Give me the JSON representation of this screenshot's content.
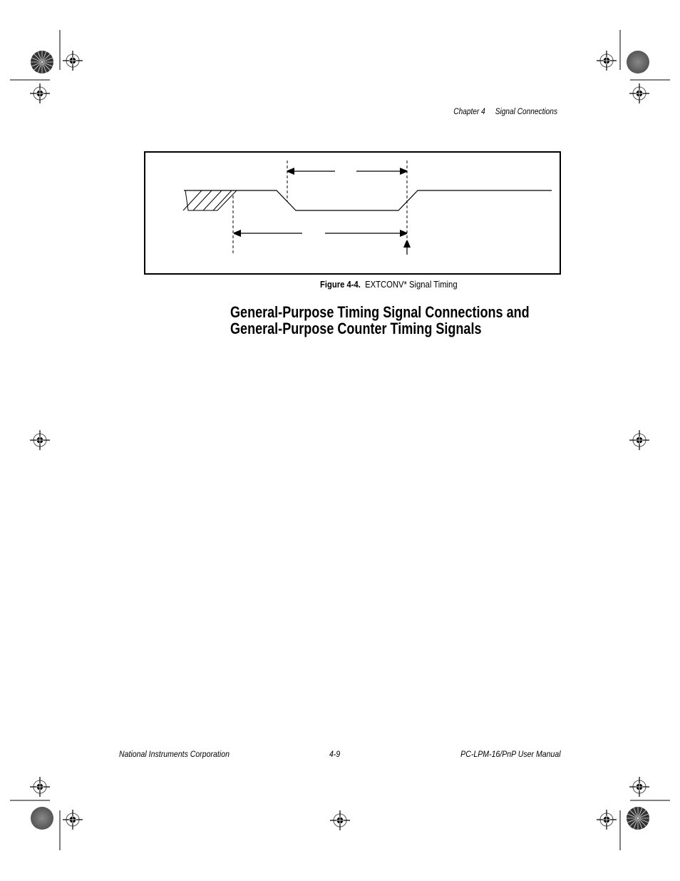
{
  "header": {
    "chapter": "Chapter 4",
    "section": "Signal Connections"
  },
  "figure": {
    "number_label": "Figure 4-4.",
    "title": "EXTCONV* Signal Timing",
    "diagram_type": "timing-diagram",
    "signal": "EXTCONV*",
    "elements": [
      "hatched-invalid-region",
      "falling-edge",
      "low-pulse",
      "rising-edge",
      "pulse-width-dimension-arrow",
      "period-dimension-arrow",
      "conversion-start-arrow"
    ]
  },
  "section": {
    "heading_line1": "General-Purpose Timing Signal Connections and",
    "heading_line2": "General-Purpose Counter Timing Signals"
  },
  "footer": {
    "left": "National Instruments Corporation",
    "center": "4-9",
    "right": "PC-LPM-16/PnP User Manual"
  }
}
